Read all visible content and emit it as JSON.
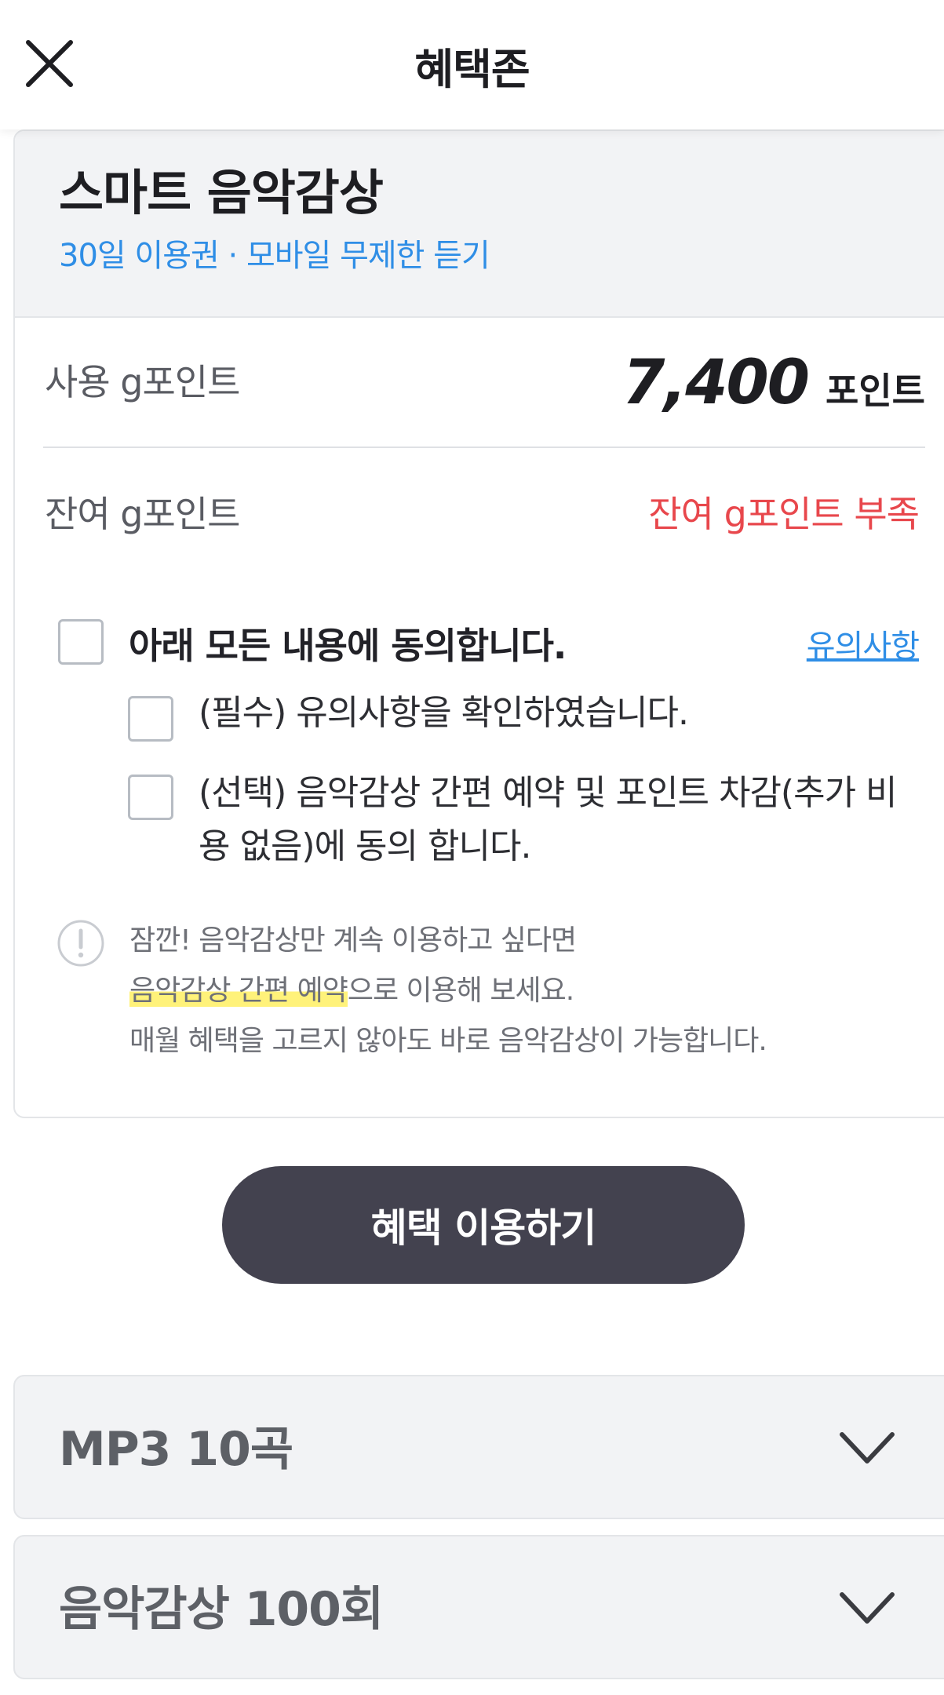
{
  "header": {
    "title": "혜택존",
    "close_icon": "close-icon"
  },
  "product": {
    "title": "스마트 음악감상",
    "subtitle": "30일 이용권 · 모바일 무제한 듣기"
  },
  "points": {
    "used_label": "사용 g포인트",
    "used_value": "7,400",
    "unit": "포인트",
    "remaining_label": "잔여 g포인트",
    "remaining_status": "잔여 g포인트 부족"
  },
  "agreements": {
    "all_label": "아래 모든 내용에 동의합니다.",
    "all_checked": false,
    "notice_link": "유의사항",
    "items": [
      {
        "label": "(필수) 유의사항을 확인하였습니다.",
        "checked": false
      },
      {
        "label": "(선택) 음악감상 간편 예약 및 포인트 차감(추가 비용 없음)에 동의 합니다.",
        "checked": false
      }
    ]
  },
  "info": {
    "icon": "exclamation-circle-icon",
    "line1": "잠깐! 음악감상만 계속 이용하고 싶다면",
    "line2_highlight": "음악감상 간편 예약",
    "line2_rest": "으로 이용해 보세요.",
    "line3": "매월 혜택을 고르지 않아도 바로 음악감상이 가능합니다.",
    "highlight_color": "#fff27a"
  },
  "cta": {
    "label": "혜택 이용하기",
    "color": "#43424f"
  },
  "accordions": [
    {
      "label": "MP3 10곡",
      "icon": "chevron-down-icon"
    },
    {
      "label": "음악감상 100회",
      "icon": "chevron-down-icon"
    }
  ],
  "colors": {
    "accent_blue": "#2f8ee6",
    "warning_red": "#e8474c",
    "panel_gray": "#f2f3f5"
  }
}
